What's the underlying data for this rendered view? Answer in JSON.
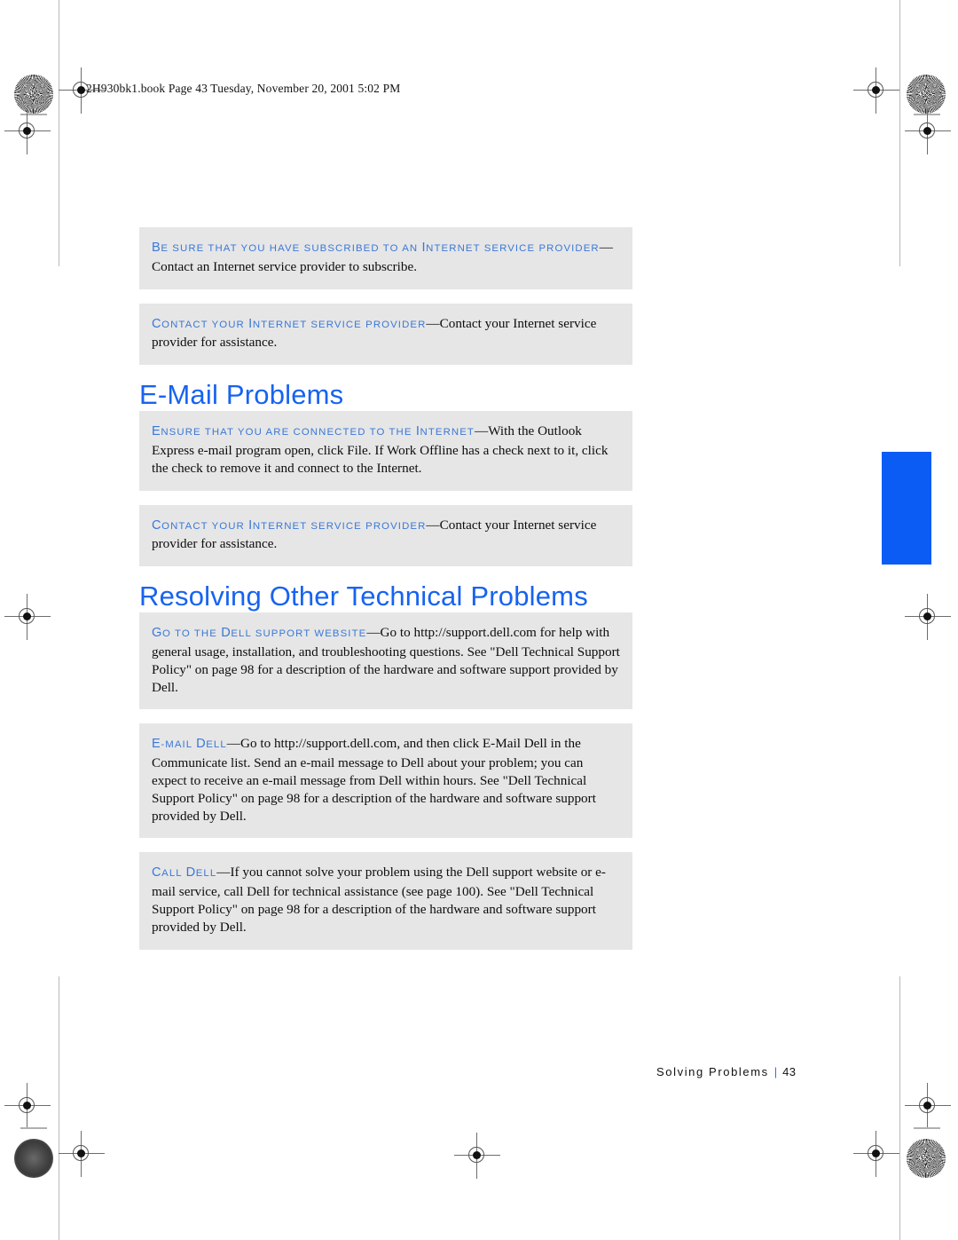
{
  "page": {
    "header_line": "2H930bk1.book  Page 43  Tuesday, November 20, 2001  5:02 PM",
    "footer_section": "Solving Problems",
    "footer_separator": "|",
    "footer_page_number": "43"
  },
  "colors": {
    "heading_blue": "#1763f0",
    "leadin_blue": "#3a78d8",
    "tab_blue": "#0a5cf5",
    "box_gray": "#e6e6e6",
    "body_text": "#0d0d0d"
  },
  "content": {
    "tips_internet": [
      {
        "lead_first_letter": "B",
        "lead_rest": "E SURE THAT YOU HAVE SUBSCRIBED TO AN ",
        "lead_cap2": "I",
        "lead_rest2": "NTERNET SERVICE PROVIDER",
        "dash": "—",
        "body": "Contact an Internet service provider to subscribe."
      },
      {
        "lead_first_letter": "C",
        "lead_rest": "ONTACT YOUR ",
        "lead_cap2": "I",
        "lead_rest2": "NTERNET SERVICE PROVIDER",
        "dash": "—",
        "body": "Contact your Internet service provider for assistance."
      }
    ],
    "heading_email": "E-Mail Problems",
    "tips_email": [
      {
        "lead_first_letter": "E",
        "lead_rest": "NSURE THAT YOU ARE CONNECTED TO THE ",
        "lead_cap2": "I",
        "lead_rest2": "NTERNET",
        "dash": "—",
        "body": "With the Outlook Express e-mail program open, click File. If Work Offline has a check next to it, click the check to remove it and connect to the Internet."
      },
      {
        "lead_first_letter": "C",
        "lead_rest": "ONTACT YOUR ",
        "lead_cap2": "I",
        "lead_rest2": "NTERNET SERVICE PROVIDER",
        "dash": "—",
        "body": "Contact your Internet service provider for assistance."
      }
    ],
    "heading_resolving": "Resolving Other Technical Problems",
    "tips_resolving": [
      {
        "lead_first_letter": "G",
        "lead_rest": "O TO THE ",
        "lead_cap2": "D",
        "lead_rest2": "ELL SUPPORT WEBSITE",
        "dash": "—",
        "body": "Go to http://support.dell.com for help with general usage, installation, and troubleshooting questions. See \"Dell Technical Support Policy\" on page 98 for a description of the hardware and software support provided by Dell."
      },
      {
        "lead_first_letter": "E",
        "lead_rest": "-MAIL ",
        "lead_cap2": "D",
        "lead_rest2": "ELL",
        "dash": "—",
        "body": "Go to http://support.dell.com, and then click E-Mail Dell in the Communicate list. Send an e-mail message to Dell about your problem; you can expect to receive an e-mail message from Dell within hours. See \"Dell Technical Support Policy\" on page 98 for a description of the hardware and software support provided by Dell."
      },
      {
        "lead_first_letter": "C",
        "lead_rest": "ALL ",
        "lead_cap2": "D",
        "lead_rest2": "ELL",
        "dash": "—",
        "body": "If you cannot solve your problem using the Dell support website or e-mail service, call Dell for technical assistance (see page 100). See \"Dell Technical Support Policy\" on page 98 for a description of the hardware and software support provided by Dell."
      }
    ]
  }
}
